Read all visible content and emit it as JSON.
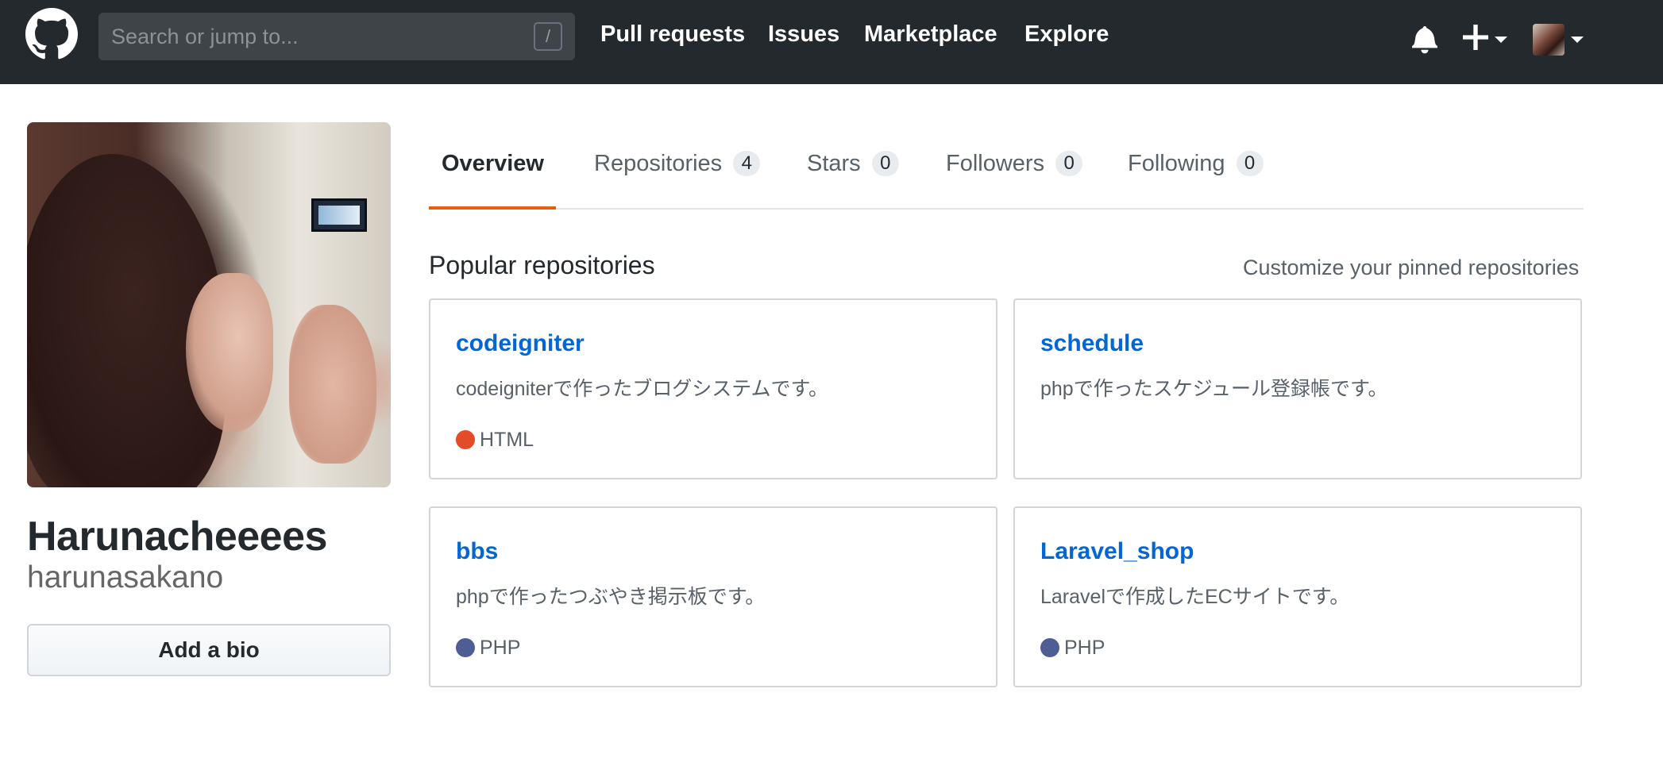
{
  "header": {
    "search_placeholder": "Search or jump to...",
    "slash_key": "/",
    "nav": [
      {
        "label": "Pull requests"
      },
      {
        "label": "Issues"
      },
      {
        "label": "Marketplace"
      },
      {
        "label": "Explore"
      }
    ],
    "icons": [
      "github-logo-icon",
      "bell-icon",
      "plus-icon",
      "caret-down-icon"
    ]
  },
  "profile": {
    "display_name": "Harunacheeees",
    "username": "harunasakano",
    "bio_button": "Add a bio"
  },
  "tabs": [
    {
      "label": "Overview",
      "count": null,
      "active": true
    },
    {
      "label": "Repositories",
      "count": "4",
      "active": false
    },
    {
      "label": "Stars",
      "count": "0",
      "active": false
    },
    {
      "label": "Followers",
      "count": "0",
      "active": false
    },
    {
      "label": "Following",
      "count": "0",
      "active": false
    }
  ],
  "popular": {
    "title": "Popular repositories",
    "customize_link": "Customize your pinned repositories",
    "repos": [
      {
        "name": "codeigniter",
        "description": "codeigniterで作ったブログシステムです。",
        "language": "HTML",
        "language_color": "#e34c26"
      },
      {
        "name": "schedule",
        "description": "phpで作ったスケジュール登録帳です。",
        "language": "",
        "language_color": ""
      },
      {
        "name": "bbs",
        "description": "phpで作ったつぶやき掲示板です。",
        "language": "PHP",
        "language_color": "#4F5D95"
      },
      {
        "name": "Laravel_shop",
        "description": "Laravelで作成したECサイトです。",
        "language": "PHP",
        "language_color": "#4F5D95"
      }
    ]
  },
  "colors": {
    "header_bg": "#24292e",
    "link": "#0366d6",
    "active_tab_underline": "#e36209"
  }
}
